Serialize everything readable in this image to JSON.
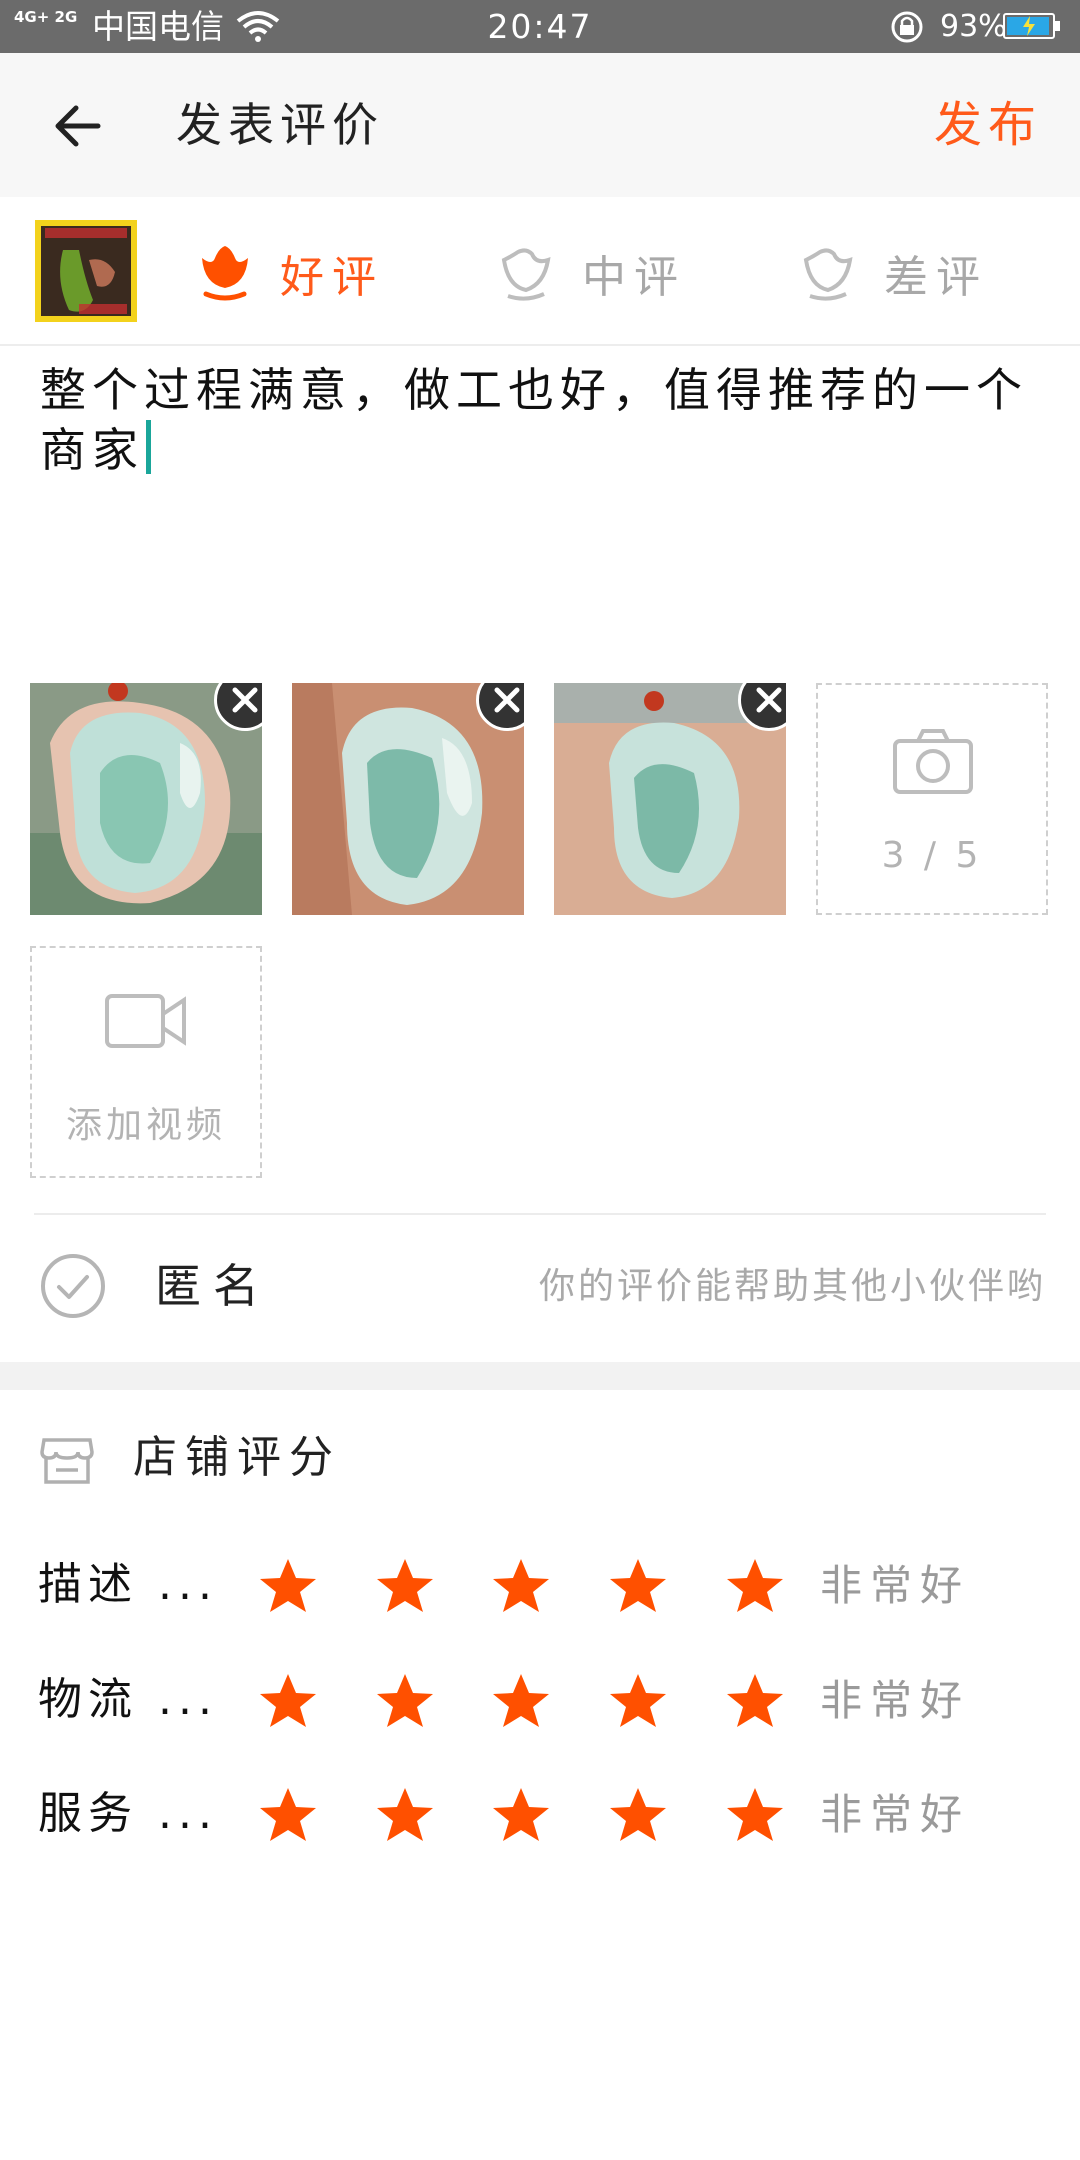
{
  "status_bar": {
    "network": "4G+ 2G",
    "carrier": "中国电信",
    "time": "20:47",
    "battery_pct": "93%",
    "icons": [
      "signal-icon",
      "wifi-icon",
      "lock-rotation-icon",
      "battery-icon"
    ]
  },
  "header": {
    "title": "发表评价",
    "publish_label": "发布",
    "back_icon": "arrow-left-icon"
  },
  "rating_options": [
    {
      "label": "好评",
      "selected": true,
      "icon": "flower-icon"
    },
    {
      "label": "中评",
      "selected": false,
      "icon": "flower-outline-icon"
    },
    {
      "label": "差评",
      "selected": false,
      "icon": "flower-outline-icon"
    }
  ],
  "review": {
    "text": "整个过程满意，做工也好，值得推荐的一个商家"
  },
  "photos": {
    "count_label": "3 / 5",
    "add_video_label": "添加视频"
  },
  "anonymous": {
    "label": "匿名",
    "hint": "你的评价能帮助其他小伙伴哟"
  },
  "shop_rating": {
    "title": "店铺评分",
    "rows": [
      {
        "label": "描述 ...",
        "stars": 5,
        "verdict": "非常好"
      },
      {
        "label": "物流 ...",
        "stars": 5,
        "verdict": "非常好"
      },
      {
        "label": "服务 ...",
        "stars": 5,
        "verdict": "非常好"
      }
    ]
  },
  "colors": {
    "accent": "#ff5a1a",
    "star": "#ff5000",
    "cursor": "#1aa69a",
    "status_bar": "#6b6b6b"
  }
}
